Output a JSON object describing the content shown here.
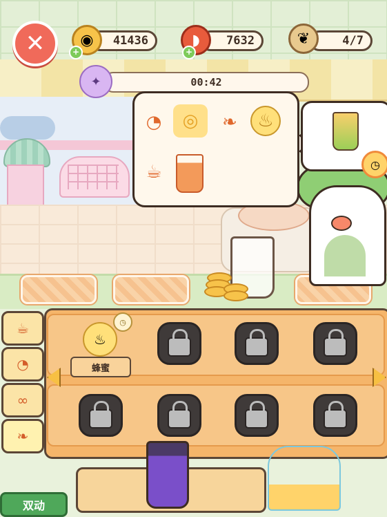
{
  "hud": {
    "coins": "41436",
    "meat": "7632",
    "bag": "4/7",
    "timer": "00:42"
  },
  "icons": {
    "close": "close-icon",
    "coin": "coin-icon",
    "meat": "meat-icon",
    "bag": "bag-icon",
    "timer": "bird-icon",
    "clock": "clock-icon",
    "lock": "lock-icon"
  },
  "recipe": {
    "ingredients": [
      "orange-icon",
      "lemon-slices-icon",
      "almond-icon",
      "honey-jar-icon",
      "cup-icon",
      "orange-juice-glass-icon"
    ]
  },
  "shelf": {
    "selected_item_label": "蜂蜜",
    "tabs": [
      "cup-tab",
      "orange-tab",
      "nuts-tab",
      "almond-tab"
    ]
  },
  "bottom": {
    "green_button_label": "双动"
  },
  "colors": {
    "shelf": "#f5b56a",
    "close": "#f06a5a",
    "accent": "#f7c043"
  }
}
